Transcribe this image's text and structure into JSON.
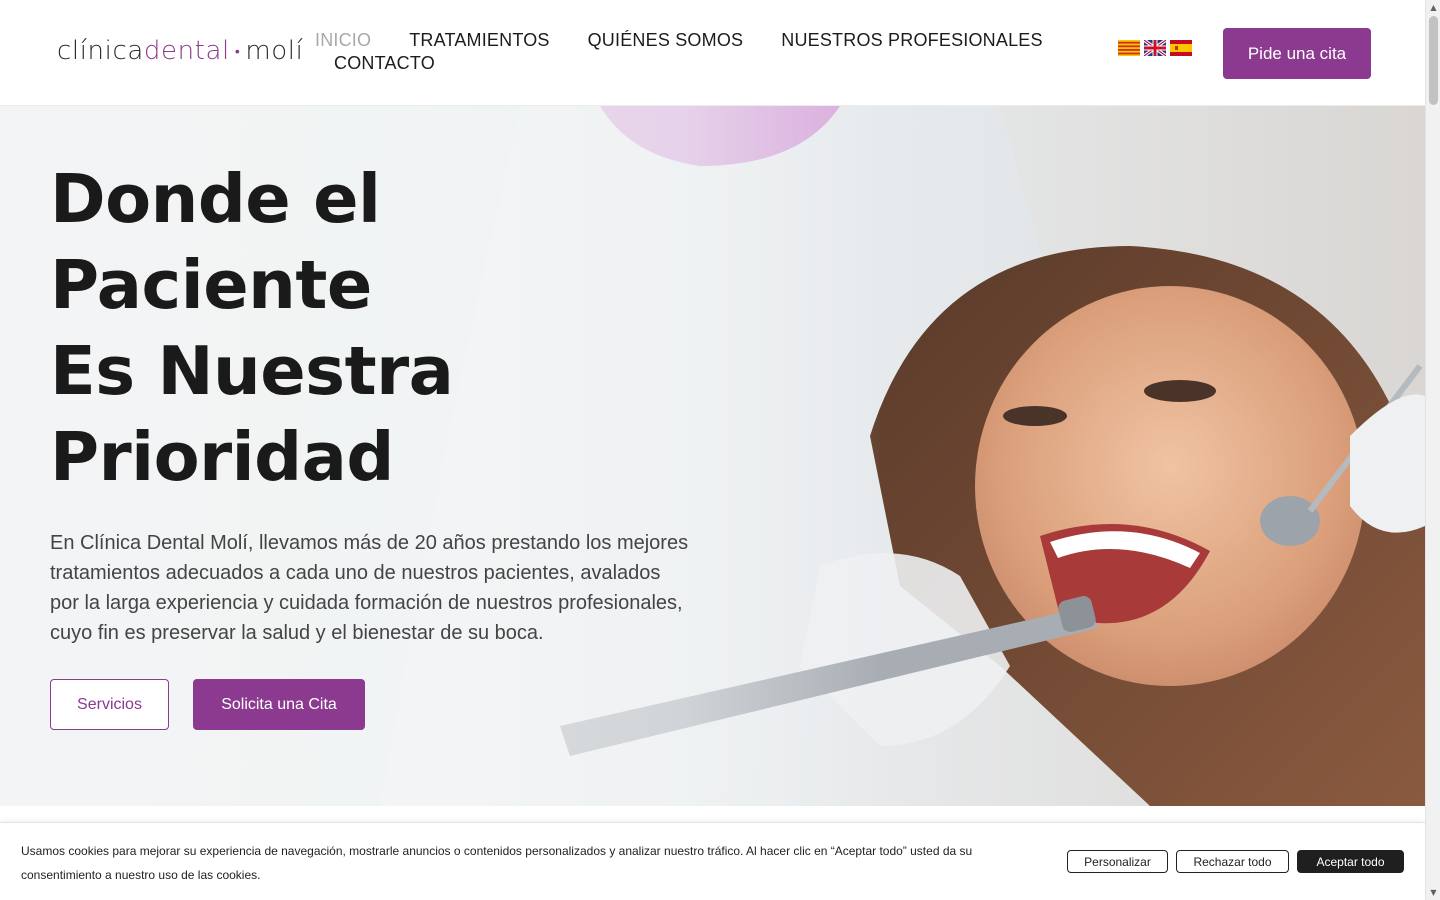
{
  "logo": {
    "part1": "clínica",
    "part2": "dental",
    "part3": "molí",
    "dot": "•"
  },
  "nav": {
    "items": [
      "INICIO",
      "TRATAMIENTOS",
      "QUIÉNES SOMOS",
      "NUESTROS PROFESIONALES",
      "CONTACTO"
    ],
    "active": "INICIO"
  },
  "languages": [
    "catalan-flag-icon",
    "uk-flag-icon",
    "spain-flag-icon"
  ],
  "header_cta": "Pide una cita",
  "hero": {
    "title_line1": "Donde el Paciente",
    "title_line2": "Es Nuestra",
    "title_line3": "Prioridad",
    "text": "En Clínica Dental Molí, llevamos más de 20 años prestando los mejores tratamientos adecuados a cada uno de nuestros pacientes, avalados por la larga experiencia y cuidada formación de nuestros profesionales, cuyo fin es preservar la salud y el bienestar de su boca.",
    "btn_services": "Servicios",
    "btn_appointment": "Solicita una Cita"
  },
  "cookie": {
    "text": "Usamos cookies para mejorar su experiencia de navegación, mostrarle anuncios o contenidos personalizados y analizar nuestro tráfico. Al hacer clic en “Aceptar todo” usted da su consentimiento a nuestro uso de las cookies.",
    "customize": "Personalizar",
    "reject": "Rechazar todo",
    "accept": "Aceptar todo"
  },
  "colors": {
    "brand_purple": "#8b3a8f",
    "nav_active": "#a9a9a9",
    "cookie_accept_bg": "#1f1f1f"
  }
}
